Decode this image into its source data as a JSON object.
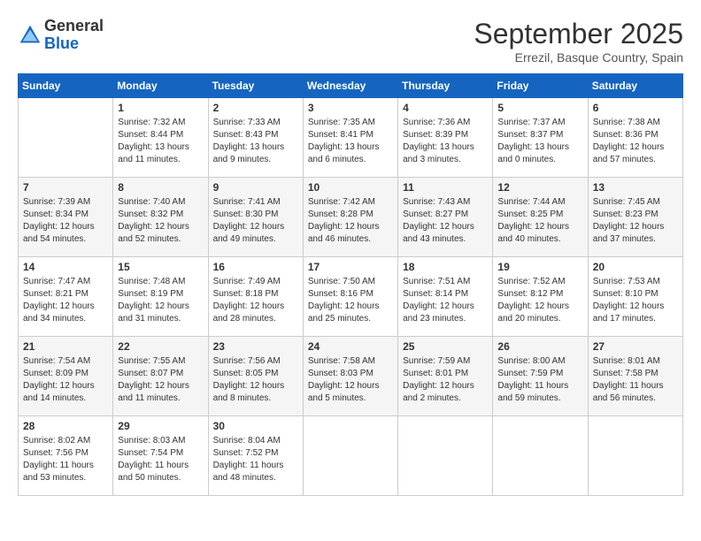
{
  "logo": {
    "general": "General",
    "blue": "Blue"
  },
  "header": {
    "month": "September 2025",
    "location": "Errezil, Basque Country, Spain"
  },
  "days_of_week": [
    "Sunday",
    "Monday",
    "Tuesday",
    "Wednesday",
    "Thursday",
    "Friday",
    "Saturday"
  ],
  "weeks": [
    [
      {
        "day": "",
        "info": ""
      },
      {
        "day": "1",
        "info": "Sunrise: 7:32 AM\nSunset: 8:44 PM\nDaylight: 13 hours\nand 11 minutes."
      },
      {
        "day": "2",
        "info": "Sunrise: 7:33 AM\nSunset: 8:43 PM\nDaylight: 13 hours\nand 9 minutes."
      },
      {
        "day": "3",
        "info": "Sunrise: 7:35 AM\nSunset: 8:41 PM\nDaylight: 13 hours\nand 6 minutes."
      },
      {
        "day": "4",
        "info": "Sunrise: 7:36 AM\nSunset: 8:39 PM\nDaylight: 13 hours\nand 3 minutes."
      },
      {
        "day": "5",
        "info": "Sunrise: 7:37 AM\nSunset: 8:37 PM\nDaylight: 13 hours\nand 0 minutes."
      },
      {
        "day": "6",
        "info": "Sunrise: 7:38 AM\nSunset: 8:36 PM\nDaylight: 12 hours\nand 57 minutes."
      }
    ],
    [
      {
        "day": "7",
        "info": "Sunrise: 7:39 AM\nSunset: 8:34 PM\nDaylight: 12 hours\nand 54 minutes."
      },
      {
        "day": "8",
        "info": "Sunrise: 7:40 AM\nSunset: 8:32 PM\nDaylight: 12 hours\nand 52 minutes."
      },
      {
        "day": "9",
        "info": "Sunrise: 7:41 AM\nSunset: 8:30 PM\nDaylight: 12 hours\nand 49 minutes."
      },
      {
        "day": "10",
        "info": "Sunrise: 7:42 AM\nSunset: 8:28 PM\nDaylight: 12 hours\nand 46 minutes."
      },
      {
        "day": "11",
        "info": "Sunrise: 7:43 AM\nSunset: 8:27 PM\nDaylight: 12 hours\nand 43 minutes."
      },
      {
        "day": "12",
        "info": "Sunrise: 7:44 AM\nSunset: 8:25 PM\nDaylight: 12 hours\nand 40 minutes."
      },
      {
        "day": "13",
        "info": "Sunrise: 7:45 AM\nSunset: 8:23 PM\nDaylight: 12 hours\nand 37 minutes."
      }
    ],
    [
      {
        "day": "14",
        "info": "Sunrise: 7:47 AM\nSunset: 8:21 PM\nDaylight: 12 hours\nand 34 minutes."
      },
      {
        "day": "15",
        "info": "Sunrise: 7:48 AM\nSunset: 8:19 PM\nDaylight: 12 hours\nand 31 minutes."
      },
      {
        "day": "16",
        "info": "Sunrise: 7:49 AM\nSunset: 8:18 PM\nDaylight: 12 hours\nand 28 minutes."
      },
      {
        "day": "17",
        "info": "Sunrise: 7:50 AM\nSunset: 8:16 PM\nDaylight: 12 hours\nand 25 minutes."
      },
      {
        "day": "18",
        "info": "Sunrise: 7:51 AM\nSunset: 8:14 PM\nDaylight: 12 hours\nand 23 minutes."
      },
      {
        "day": "19",
        "info": "Sunrise: 7:52 AM\nSunset: 8:12 PM\nDaylight: 12 hours\nand 20 minutes."
      },
      {
        "day": "20",
        "info": "Sunrise: 7:53 AM\nSunset: 8:10 PM\nDaylight: 12 hours\nand 17 minutes."
      }
    ],
    [
      {
        "day": "21",
        "info": "Sunrise: 7:54 AM\nSunset: 8:09 PM\nDaylight: 12 hours\nand 14 minutes."
      },
      {
        "day": "22",
        "info": "Sunrise: 7:55 AM\nSunset: 8:07 PM\nDaylight: 12 hours\nand 11 minutes."
      },
      {
        "day": "23",
        "info": "Sunrise: 7:56 AM\nSunset: 8:05 PM\nDaylight: 12 hours\nand 8 minutes."
      },
      {
        "day": "24",
        "info": "Sunrise: 7:58 AM\nSunset: 8:03 PM\nDaylight: 12 hours\nand 5 minutes."
      },
      {
        "day": "25",
        "info": "Sunrise: 7:59 AM\nSunset: 8:01 PM\nDaylight: 12 hours\nand 2 minutes."
      },
      {
        "day": "26",
        "info": "Sunrise: 8:00 AM\nSunset: 7:59 PM\nDaylight: 11 hours\nand 59 minutes."
      },
      {
        "day": "27",
        "info": "Sunrise: 8:01 AM\nSunset: 7:58 PM\nDaylight: 11 hours\nand 56 minutes."
      }
    ],
    [
      {
        "day": "28",
        "info": "Sunrise: 8:02 AM\nSunset: 7:56 PM\nDaylight: 11 hours\nand 53 minutes."
      },
      {
        "day": "29",
        "info": "Sunrise: 8:03 AM\nSunset: 7:54 PM\nDaylight: 11 hours\nand 50 minutes."
      },
      {
        "day": "30",
        "info": "Sunrise: 8:04 AM\nSunset: 7:52 PM\nDaylight: 11 hours\nand 48 minutes."
      },
      {
        "day": "",
        "info": ""
      },
      {
        "day": "",
        "info": ""
      },
      {
        "day": "",
        "info": ""
      },
      {
        "day": "",
        "info": ""
      }
    ]
  ]
}
